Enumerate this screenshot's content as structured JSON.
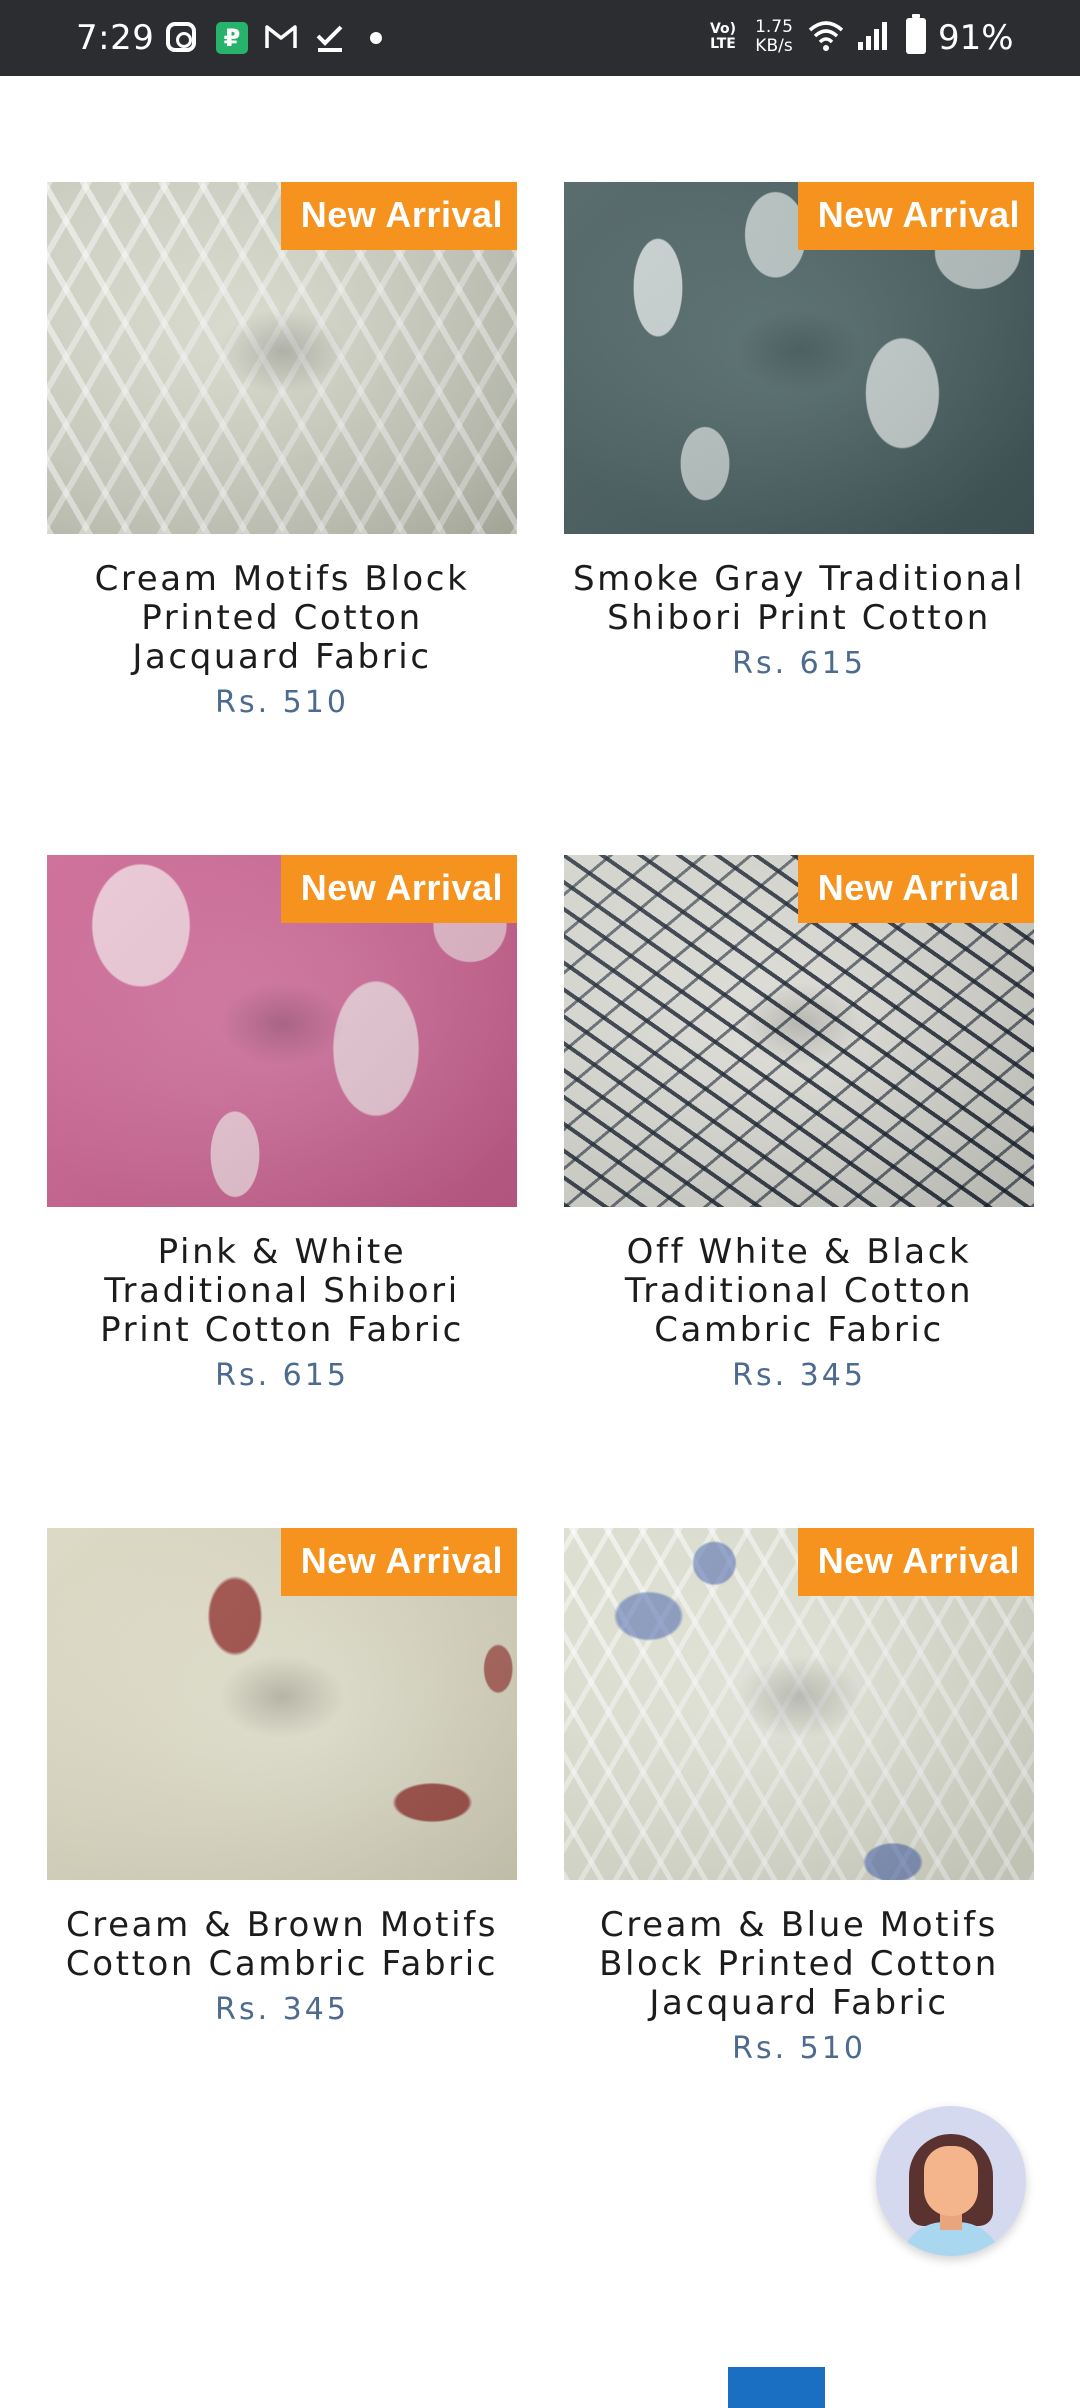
{
  "status_bar": {
    "time": "7:29",
    "network_type": "Vo) LTE",
    "speed": "1.75 KB/s",
    "battery": "91%",
    "icons": [
      "instagram-icon",
      "payment-app-icon",
      "gmail-icon",
      "tasks-icon",
      "notification-dot-icon",
      "wifi-icon",
      "signal-icon",
      "battery-icon"
    ]
  },
  "products": [
    {
      "badge": "New Arrival",
      "title": "Cream Motifs Block Printed Cotton Jacquard Fabric",
      "price": "Rs. 510"
    },
    {
      "badge": "New Arrival",
      "title": "Smoke Gray Traditional Shibori Print Cotton",
      "price": "Rs. 615"
    },
    {
      "badge": "New Arrival",
      "title": "Pink & White Traditional Shibori Print Cotton Fabric",
      "price": "Rs. 615"
    },
    {
      "badge": "New Arrival",
      "title": "Off White & Black Traditional Cotton Cambric Fabric",
      "price": "Rs. 345"
    },
    {
      "badge": "New Arrival",
      "title": "Cream & Brown Motifs Cotton Cambric Fabric",
      "price": "Rs. 345"
    },
    {
      "badge": "New Arrival",
      "title": "Cream & Blue Motifs Block Printed Cotton Jacquard Fabric",
      "price": "Rs. 510"
    }
  ],
  "colors": {
    "badge": "#f6931e",
    "price": "#4d6b8e",
    "status_bar": "#2b2d31",
    "bottom_button": "#1a6fc3"
  },
  "chat": {
    "icon": "chat-assistant-avatar-icon"
  }
}
